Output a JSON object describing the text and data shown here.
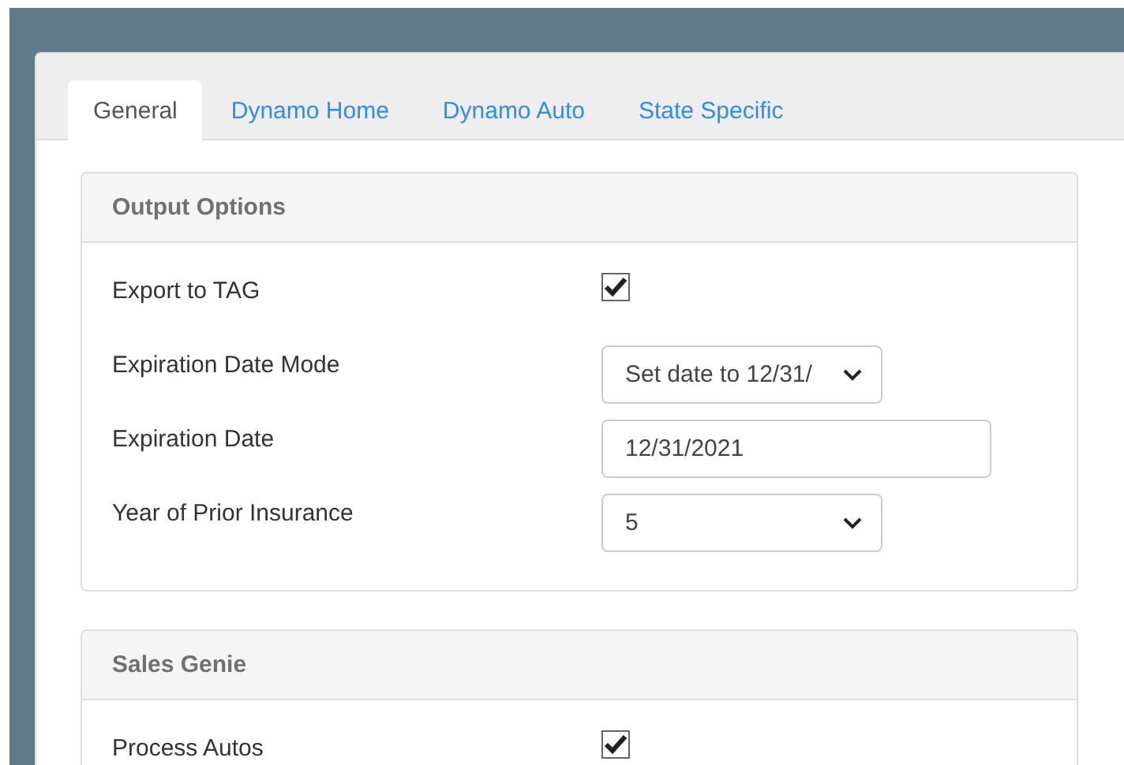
{
  "tabs": [
    {
      "label": "General",
      "selected": true
    },
    {
      "label": "Dynamo Home",
      "selected": false
    },
    {
      "label": "Dynamo Auto",
      "selected": false
    },
    {
      "label": "State Specific",
      "selected": false
    }
  ],
  "panels": [
    {
      "title": "Output Options",
      "fields": [
        {
          "label": "Export to TAG",
          "kind": "checkbox",
          "checked": true
        },
        {
          "label": "Expiration Date Mode",
          "kind": "select",
          "value": "Set date to 12/31/"
        },
        {
          "label": "Expiration Date",
          "kind": "text",
          "value": "12/31/2021"
        },
        {
          "label": "Year of Prior Insurance",
          "kind": "select",
          "value": "5"
        }
      ]
    },
    {
      "title": "Sales Genie",
      "fields": [
        {
          "label": "Process Autos",
          "kind": "checkbox",
          "checked": true
        }
      ]
    }
  ]
}
